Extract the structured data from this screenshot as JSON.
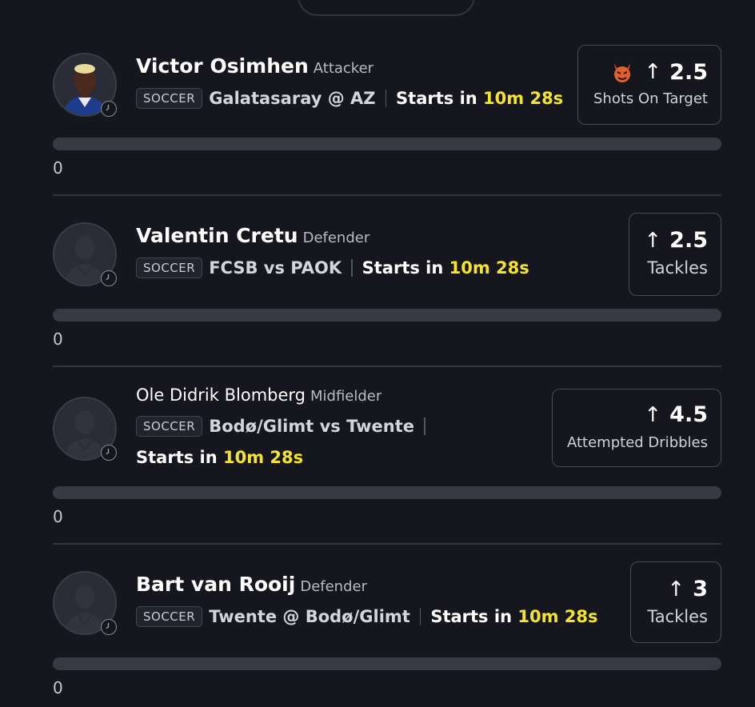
{
  "colors": {
    "background": "#16161f",
    "countdown": "#f5e52a",
    "badge_border": "#44444f",
    "track": "#393943"
  },
  "players": [
    {
      "name": "Victor Osimhen",
      "position": "Attacker",
      "sport": "SOCCER",
      "matchup": "Galatasaray @ AZ",
      "starts_prefix": "Starts in",
      "countdown": "10m 28s",
      "direction": "up-arrow-icon",
      "line": "2.5",
      "stat": "Shots On Target",
      "has_demon_icon": true,
      "progress_value": "0",
      "progress_fraction": 0,
      "avatar": "player-photo"
    },
    {
      "name": "Valentin Cretu",
      "position": "Defender",
      "sport": "SOCCER",
      "matchup": "FCSB vs PAOK",
      "starts_prefix": "Starts in",
      "countdown": "10m 28s",
      "direction": "up-arrow-icon",
      "line": "2.5",
      "stat": "Tackles",
      "progress_value": "0",
      "progress_fraction": 0,
      "avatar": "placeholder-silhouette"
    },
    {
      "name": "Ole Didrik Blomberg",
      "position": "Midfielder",
      "sport": "SOCCER",
      "matchup": "Bodø/Glimt vs Twente",
      "starts_prefix": "Starts in",
      "countdown": "10m 28s",
      "direction": "up-arrow-icon",
      "line": "4.5",
      "stat": "Attempted Dribbles",
      "progress_value": "0",
      "progress_fraction": 0,
      "avatar": "placeholder-silhouette"
    },
    {
      "name": "Bart van Rooij",
      "position": "Defender",
      "sport": "SOCCER",
      "matchup": "Twente @ Bodø/Glimt",
      "starts_prefix": "Starts in",
      "countdown": "10m 28s",
      "direction": "up-arrow-icon",
      "line": "3",
      "stat": "Tackles",
      "progress_value": "0",
      "progress_fraction": 0,
      "avatar": "placeholder-silhouette"
    }
  ]
}
